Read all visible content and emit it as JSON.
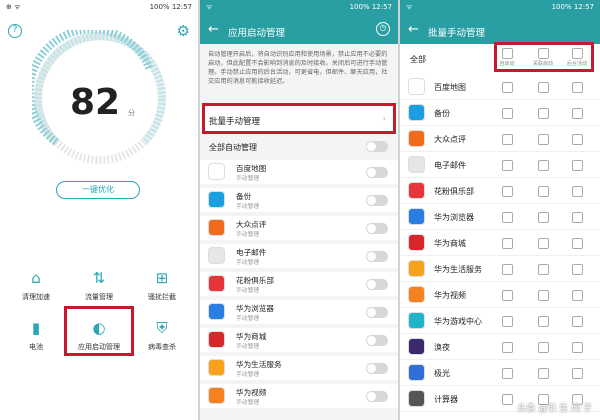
{
  "status": {
    "p1": {
      "left": "⊕ ᯤ",
      "battery": "100%",
      "time": "12:57"
    },
    "p2": {
      "left": "ᯤ",
      "battery": "100%",
      "time": "12:57"
    },
    "p3": {
      "left": "ᯤ",
      "battery": "100%",
      "time": "12:57"
    }
  },
  "home": {
    "score": "82",
    "score_unit": "分",
    "optimize_label": "一键优化",
    "tools": [
      {
        "label": "清理加速",
        "icon": "broom-icon"
      },
      {
        "label": "流量管理",
        "icon": "data-icon"
      },
      {
        "label": "骚扰拦截",
        "icon": "block-icon"
      },
      {
        "label": "电池",
        "icon": "battery-icon"
      },
      {
        "label": "应用启动管理",
        "icon": "toggle-icon"
      },
      {
        "label": "病毒查杀",
        "icon": "shield-icon"
      }
    ]
  },
  "startup": {
    "title": "应用启动管理",
    "description": "自动管理开启后，将自动识别应用和使用场景，禁止应用不必要的启动，但此配置不会影响到消息的及时接收。关闭后可进行手动管理。手动禁止应用的后台活动，可更省电，但邮件、聊天应用，社交应用的消息可能接收延迟。",
    "batch_label": "批量手动管理",
    "batch_arrow": "›",
    "all_auto_label": "全部自动管理",
    "apps": [
      {
        "name": "百度地图",
        "sub": "手动管理",
        "color": "#ffffff"
      },
      {
        "name": "备份",
        "sub": "手动管理",
        "color": "#1a9fe0"
      },
      {
        "name": "大众点评",
        "sub": "手动管理",
        "color": "#f26a1b"
      },
      {
        "name": "电子邮件",
        "sub": "手动管理",
        "color": "#e6e6e6"
      },
      {
        "name": "花粉俱乐部",
        "sub": "手动管理",
        "color": "#e8333a"
      },
      {
        "name": "华为浏览器",
        "sub": "手动管理",
        "color": "#2a7de1"
      },
      {
        "name": "华为商城",
        "sub": "手动管理",
        "color": "#d8262a"
      },
      {
        "name": "华为生活服务",
        "sub": "手动管理",
        "color": "#f7a21b"
      },
      {
        "name": "华为视频",
        "sub": "手动管理",
        "color": "#f5821f"
      }
    ]
  },
  "batch": {
    "title": "批量手动管理",
    "all_label": "全部",
    "columns": [
      "自启动",
      "关联启动",
      "后台活动"
    ],
    "apps": [
      {
        "name": "百度地图",
        "color": "#ffffff"
      },
      {
        "name": "备份",
        "color": "#1a9fe0"
      },
      {
        "name": "大众点评",
        "color": "#f26a1b"
      },
      {
        "name": "电子邮件",
        "color": "#e6e6e6"
      },
      {
        "name": "花粉俱乐部",
        "color": "#e8333a"
      },
      {
        "name": "华为浏览器",
        "color": "#2a7de1"
      },
      {
        "name": "华为商城",
        "color": "#d8262a"
      },
      {
        "name": "华为生活服务",
        "color": "#f7a21b"
      },
      {
        "name": "华为视频",
        "color": "#f5821f"
      },
      {
        "name": "华为游戏中心",
        "color": "#1fb5c9"
      },
      {
        "name": "涣夜",
        "color": "#3b2a6b"
      },
      {
        "name": "极光",
        "color": "#2f6fd6"
      },
      {
        "name": "计算器",
        "color": "#555555"
      }
    ],
    "watermark": "头条 @引 生 问 子"
  },
  "colors": {
    "accent": "#2a9fa3",
    "highlight": "#c7192e"
  }
}
